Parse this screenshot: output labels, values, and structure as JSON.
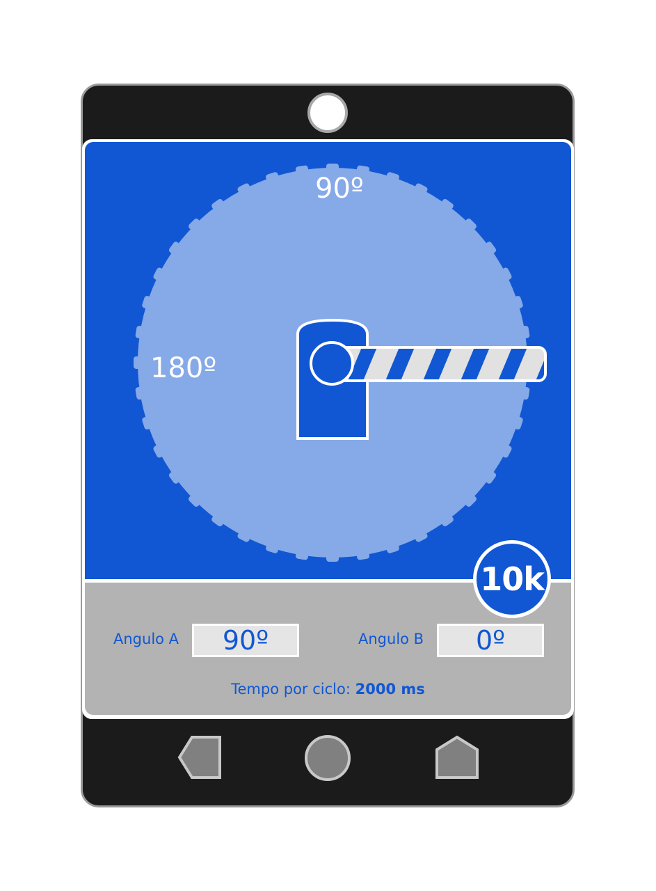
{
  "dial": {
    "label_top": "90º",
    "label_left": "180º"
  },
  "badge": {
    "speed": "10k"
  },
  "fields": {
    "angle_a_label": "Angulo A",
    "angle_a_value": "90º",
    "angle_b_label": "Angulo B",
    "angle_b_value": "0º"
  },
  "cycle": {
    "label": "Tempo por ciclo:",
    "value": "2000 ms"
  },
  "nav": {
    "back_icon": "back-pentagon-icon",
    "home_icon": "home-circle-icon",
    "recent_icon": "recent-pentagon-icon"
  },
  "colors": {
    "primary_blue": "#1157d3",
    "dial_fill": "#86a9e7",
    "panel_gray": "#b3b3b3",
    "device_frame": "#1b1b1b"
  }
}
